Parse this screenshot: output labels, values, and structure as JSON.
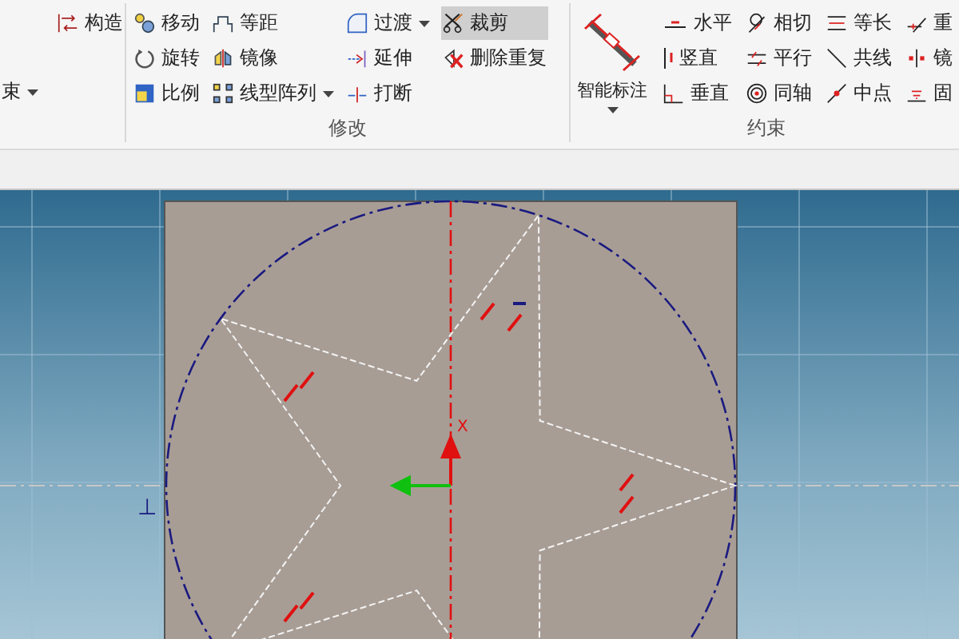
{
  "ribbon": {
    "groups": [
      {
        "columns": [
          [
            {
              "label": "构造",
              "selected": false
            },
            {
              "label": "束",
              "selected": false,
              "dropdown": true
            }
          ]
        ]
      },
      {
        "label": "修改",
        "columns": [
          [
            {
              "label": "移动",
              "selected": false
            },
            {
              "label": "旋转",
              "selected": false
            },
            {
              "label": "比例",
              "selected": false
            }
          ],
          [
            {
              "label": "等距",
              "selected": false
            },
            {
              "label": "镜像",
              "selected": false
            },
            {
              "label": "线型阵列",
              "selected": false,
              "dropdown": true
            }
          ],
          [
            {
              "label": "过渡",
              "selected": false,
              "dropdown": true
            },
            {
              "label": "延伸",
              "selected": false
            },
            {
              "label": "打断",
              "selected": false
            }
          ],
          [
            {
              "label": "裁剪",
              "selected": true
            },
            {
              "label": "删除重复",
              "selected": false
            }
          ]
        ]
      },
      {
        "label": "约束",
        "big": {
          "label": "智能标注",
          "dropdown": true
        },
        "columns": [
          [
            {
              "label": "水平",
              "selected": false
            },
            {
              "label": "竖直",
              "selected": false
            },
            {
              "label": "垂直",
              "selected": false
            }
          ],
          [
            {
              "label": "相切",
              "selected": false
            },
            {
              "label": "平行",
              "selected": false
            },
            {
              "label": "同轴",
              "selected": false
            }
          ],
          [
            {
              "label": "等长",
              "selected": false
            },
            {
              "label": "共线",
              "selected": false
            },
            {
              "label": "中点",
              "selected": false
            }
          ],
          [
            {
              "label": "重",
              "selected": false
            },
            {
              "label": "镜",
              "selected": false
            },
            {
              "label": "固",
              "selected": false
            }
          ]
        ]
      }
    ]
  },
  "canvas": {
    "axis_label": "X",
    "constraint_label": "⊥"
  }
}
